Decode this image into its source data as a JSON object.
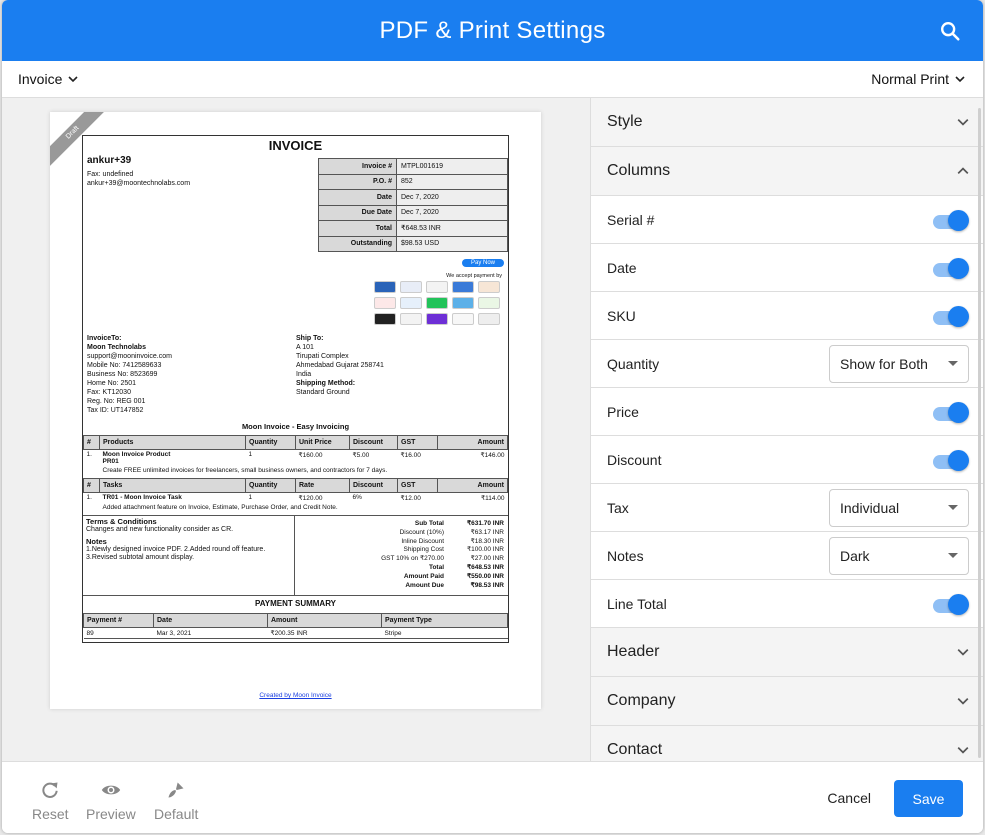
{
  "header": {
    "title": "PDF & Print Settings",
    "search_icon": "search-icon"
  },
  "subbar": {
    "doc_type": "Invoice",
    "print_mode": "Normal Print"
  },
  "invoice": {
    "draft": "Draft",
    "title": "INVOICE",
    "company": {
      "name": "ankur+39",
      "fax": "Fax: undefined",
      "email": "ankur+39@moontechnolabs.com"
    },
    "meta": [
      {
        "k": "Invoice #",
        "v": "MTPL001619"
      },
      {
        "k": "P.O. #",
        "v": "852"
      },
      {
        "k": "Date",
        "v": "Dec 7, 2020"
      },
      {
        "k": "Due Date",
        "v": "Dec 7, 2020"
      },
      {
        "k": "Total",
        "v": "₹648.53 INR"
      },
      {
        "k": "Outstanding",
        "v": "$98.53 USD"
      }
    ],
    "pay_now": "Pay Now",
    "accept": "We accept payment by",
    "bill_to": {
      "label": "InvoiceTo:",
      "lines": [
        "Moon Technolabs",
        "support@mooninvoice.com",
        "Mobile No: 7412589633",
        "Business No: 8523699",
        "Home No: 2501",
        "Fax: KT12030",
        "Reg. No: REG 001",
        "Tax ID: UT147852"
      ]
    },
    "ship_to": {
      "label": "Ship To:",
      "lines": [
        "A 101",
        "Tirupati Complex",
        "Ahmedabad Gujarat 258741",
        "India"
      ],
      "method_label": "Shipping Method:",
      "method": "Standard Ground"
    },
    "easy": "Moon Invoice - Easy Invoicing",
    "products": {
      "headers": [
        "#",
        "Products",
        "Quantity",
        "Unit Price",
        "Discount",
        "GST",
        "Amount"
      ],
      "row": [
        "1.",
        "Moon Invoice Product",
        "1",
        "₹160.00",
        "₹5.00",
        "₹16.00",
        "₹146.00"
      ],
      "sku": "PR01",
      "desc": "Create FREE unlimited invoices for freelancers, small business owners, and contractors for 7 days."
    },
    "tasks": {
      "headers": [
        "#",
        "Tasks",
        "Quantity",
        "Rate",
        "Discount",
        "GST",
        "Amount"
      ],
      "row": [
        "1.",
        "TR01 - Moon Invoice Task",
        "1",
        "₹120.00",
        "6%",
        "₹12.00",
        "₹114.00"
      ],
      "desc": "Added attachment feature on Invoice, Estimate, Purchase Order, and Credit Note."
    },
    "terms": {
      "title": "Terms & Conditions",
      "text": "Changes and new functionality consider as CR.",
      "notes_title": "Notes",
      "notes": "1.Newly designed invoice PDF.  2.Added round off feature. 3.Revised subtotal amount display."
    },
    "totals": [
      {
        "k": "Sub Total",
        "v": "₹631.70  INR"
      },
      {
        "k": "Discount (10%)",
        "v": "₹63.17  INR"
      },
      {
        "k": "Inline Discount",
        "v": "₹18.30  INR"
      },
      {
        "k": "Shipping Cost",
        "v": "₹100.00  INR"
      },
      {
        "k": "GST 10% on ₹270.00",
        "v": "₹27.00  INR"
      },
      {
        "k": "Total",
        "v": "₹648.53  INR"
      },
      {
        "k": "Amount Paid",
        "v": "₹550.00  INR"
      },
      {
        "k": "Amount Due",
        "v": "₹98.53  INR"
      }
    ],
    "payment_summary": {
      "title": "PAYMENT SUMMARY",
      "headers": [
        "Payment #",
        "Date",
        "Amount",
        "Payment Type"
      ],
      "row": [
        "89",
        "Mar 3, 2021",
        "₹200.35  INR",
        "Stripe"
      ]
    },
    "footer_link": "Created by Moon Invoice"
  },
  "settings": {
    "sections": {
      "style": "Style",
      "columns": "Columns",
      "header": "Header",
      "company": "Company",
      "contact": "Contact"
    },
    "options": {
      "serial": {
        "label": "Serial #",
        "on": true
      },
      "date": {
        "label": "Date",
        "on": true
      },
      "sku": {
        "label": "SKU",
        "on": true
      },
      "quantity": {
        "label": "Quantity",
        "value": "Show for Both"
      },
      "price": {
        "label": "Price",
        "on": true
      },
      "discount": {
        "label": "Discount",
        "on": true
      },
      "tax": {
        "label": "Tax",
        "value": "Individual"
      },
      "notes": {
        "label": "Notes",
        "value": "Dark"
      },
      "line_total": {
        "label": "Line Total",
        "on": true
      }
    }
  },
  "footer": {
    "reset": "Reset",
    "preview": "Preview",
    "default": "Default",
    "cancel": "Cancel",
    "save": "Save"
  },
  "colors": {
    "primary": "#1a7ef0",
    "toggle_track": "#8fbff5"
  }
}
